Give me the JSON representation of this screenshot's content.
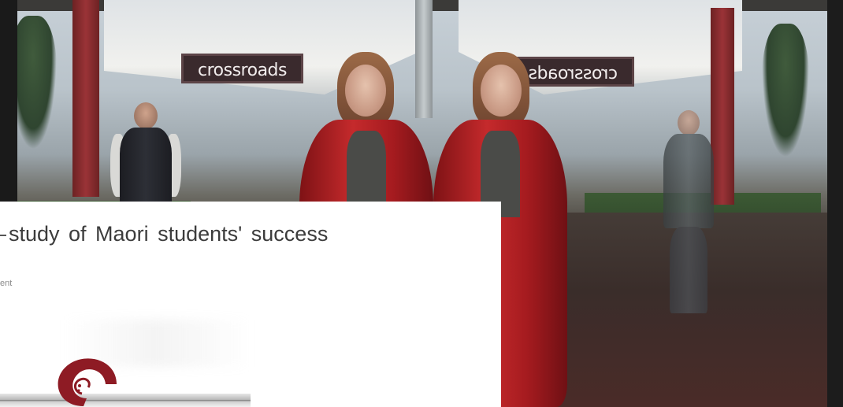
{
  "photo": {
    "sign_left": "crossroads",
    "sign_right": "crossroads"
  },
  "card": {
    "headline": "study  of  Maori  students'  success",
    "subtext": "ent"
  },
  "icons": {
    "logo": "koru-logo-icon"
  },
  "colors": {
    "coat_red": "#c52a2c",
    "pillar_red": "#9a3337",
    "logo_red": "#8e1b24",
    "headline_text": "#3c3c3c"
  }
}
